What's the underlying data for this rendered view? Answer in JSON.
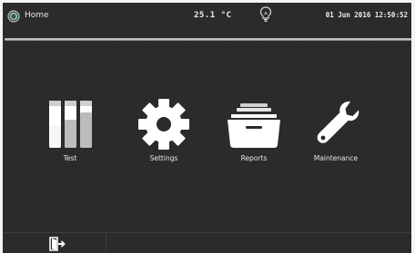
{
  "header": {
    "title": "Home",
    "temperature": "25.1 °C",
    "datetime": "01 Jun 2016  12:50:52"
  },
  "main": {
    "tiles": [
      {
        "label": "Test",
        "icon": "test-tubes-icon"
      },
      {
        "label": "Settings",
        "icon": "gear-icon"
      },
      {
        "label": "Reports",
        "icon": "folder-icon"
      },
      {
        "label": "Maintenance",
        "icon": "wrench-icon"
      }
    ]
  },
  "bottom_bar": {
    "exit_icon": "exit-door-icon"
  },
  "colors": {
    "background": "#2b2b2b",
    "icon": "#ffffff",
    "text": "#e8e8e8"
  }
}
